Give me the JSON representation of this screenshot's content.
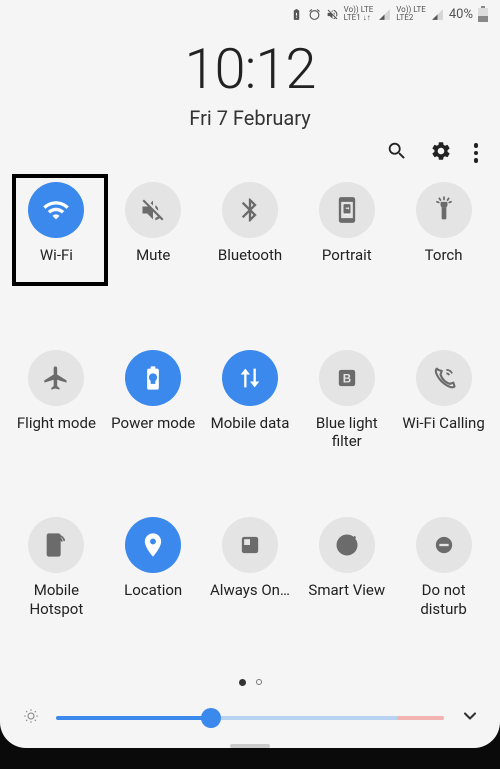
{
  "status": {
    "battery_pct": "40%",
    "net1": "Vo)) LTE",
    "net1b": "LTE1 ↓↑",
    "net2": "Vo)) LTE",
    "net2b": "LTE2"
  },
  "clock": "10:12",
  "date": "Fri 7 February",
  "tiles": [
    {
      "id": "wifi",
      "label": "Wi-Fi",
      "on": true
    },
    {
      "id": "mute",
      "label": "Mute",
      "on": false
    },
    {
      "id": "bluetooth",
      "label": "Bluetooth",
      "on": false
    },
    {
      "id": "portrait",
      "label": "Portrait",
      "on": false
    },
    {
      "id": "torch",
      "label": "Torch",
      "on": false
    },
    {
      "id": "flight",
      "label": "Flight mode",
      "on": false
    },
    {
      "id": "power",
      "label": "Power mode",
      "on": true
    },
    {
      "id": "mobiledata",
      "label": "Mobile data",
      "on": true
    },
    {
      "id": "bluelight",
      "label": "Blue light filter",
      "on": false
    },
    {
      "id": "wificalling",
      "label": "Wi-Fi Calling",
      "on": false
    },
    {
      "id": "hotspot",
      "label": "Mobile Hotspot",
      "on": false
    },
    {
      "id": "location",
      "label": "Location",
      "on": true
    },
    {
      "id": "always",
      "label": "Always On…",
      "on": false
    },
    {
      "id": "smartview",
      "label": "Smart View",
      "on": false
    },
    {
      "id": "dnd",
      "label": "Do not disturb",
      "on": false
    }
  ],
  "pager": {
    "current": 0,
    "count": 2
  },
  "brightness": {
    "value": 40
  }
}
